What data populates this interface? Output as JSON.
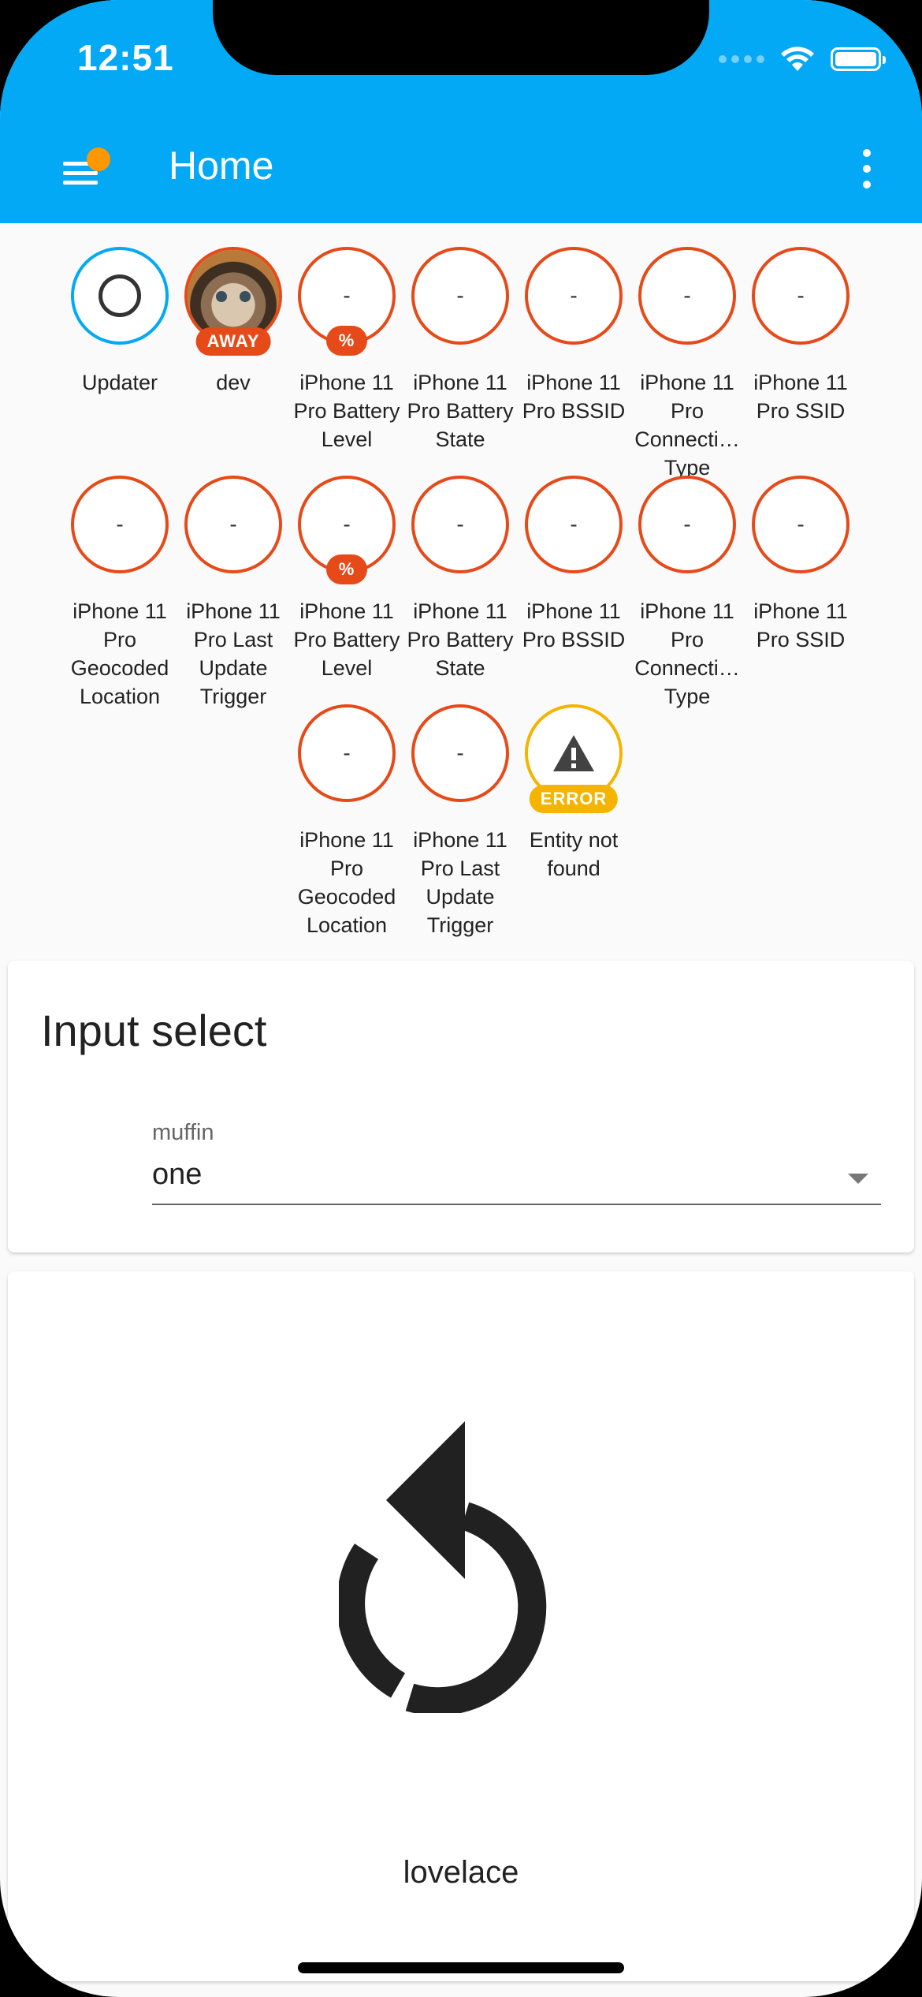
{
  "status_bar": {
    "time": "12:51"
  },
  "header": {
    "title": "Home"
  },
  "badges": [
    {
      "label": "Updater",
      "state": "",
      "pill": "",
      "kind": "updater"
    },
    {
      "label": "dev",
      "state": "",
      "pill": "AWAY",
      "kind": "photo"
    },
    {
      "label": "iPhone 11 Pro Battery Level",
      "state": "-",
      "pill": "%",
      "kind": "sensor"
    },
    {
      "label": "iPhone 11 Pro Battery State",
      "state": "-",
      "pill": "",
      "kind": "sensor"
    },
    {
      "label": "iPhone 11 Pro BSSID",
      "state": "-",
      "pill": "",
      "kind": "sensor"
    },
    {
      "label": "iPhone 11 Pro Connecti… Type",
      "state": "-",
      "pill": "",
      "kind": "sensor"
    },
    {
      "label": "iPhone 11 Pro SSID",
      "state": "-",
      "pill": "",
      "kind": "sensor"
    },
    {
      "label": "iPhone 11 Pro Geocoded Location",
      "state": "-",
      "pill": "",
      "kind": "sensor"
    },
    {
      "label": "iPhone 11 Pro Last Update Trigger",
      "state": "-",
      "pill": "",
      "kind": "sensor"
    },
    {
      "label": "iPhone 11 Pro Battery Level",
      "state": "-",
      "pill": "%",
      "kind": "sensor"
    },
    {
      "label": "iPhone 11 Pro Battery State",
      "state": "-",
      "pill": "",
      "kind": "sensor"
    },
    {
      "label": "iPhone 11 Pro BSSID",
      "state": "-",
      "pill": "",
      "kind": "sensor"
    },
    {
      "label": "iPhone 11 Pro Connecti… Type",
      "state": "-",
      "pill": "",
      "kind": "sensor"
    },
    {
      "label": "iPhone 11 Pro SSID",
      "state": "-",
      "pill": "",
      "kind": "sensor"
    },
    {
      "label": "iPhone 11 Pro Geocoded Location",
      "state": "-",
      "pill": "",
      "kind": "sensor"
    },
    {
      "label": "iPhone 11 Pro Last Update Trigger",
      "state": "-",
      "pill": "",
      "kind": "sensor"
    },
    {
      "label": "Entity not found",
      "state": "",
      "pill": "ERROR",
      "kind": "error"
    }
  ],
  "input_select_card": {
    "title": "Input select",
    "field_label": "muffin",
    "value": "one"
  },
  "refresh_card": {
    "label": "lovelace"
  },
  "colors": {
    "header": "#03a9f4",
    "badge_ring": "#e64a19",
    "error": "#f4b400",
    "menu_dot": "#ff9800"
  }
}
